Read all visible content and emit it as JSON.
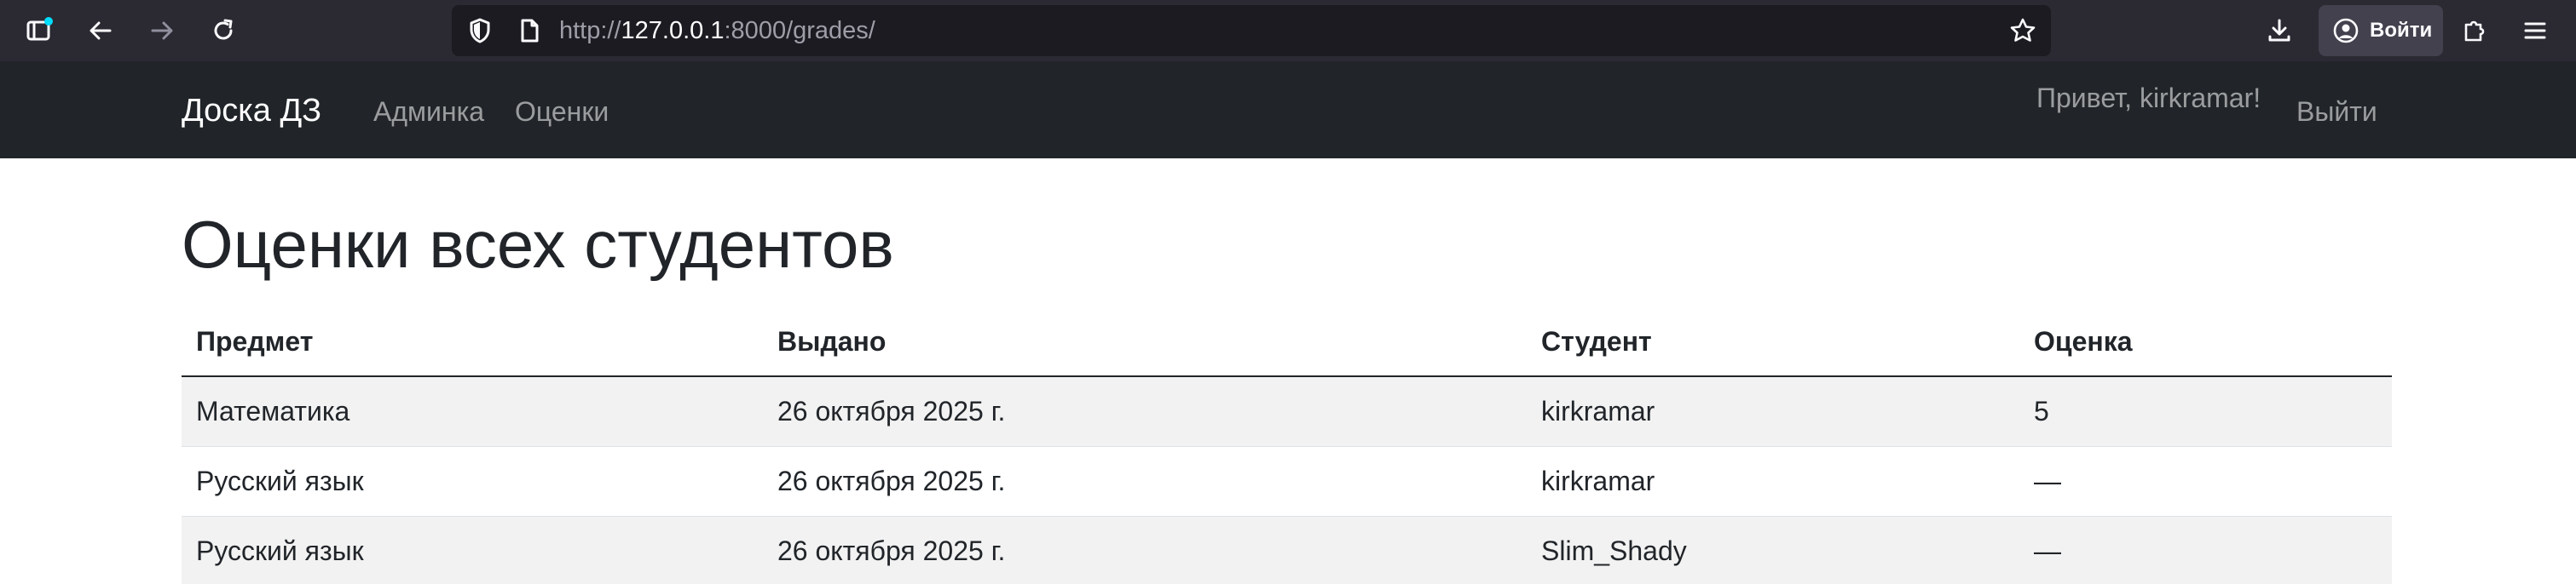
{
  "browser": {
    "url_prefix": "http://",
    "url_host": "127.0.0.1",
    "url_path": ":8000/grades/",
    "signin_label": "Войти",
    "accent": "#2b2a33"
  },
  "navbar": {
    "brand": "Доска ДЗ",
    "links": [
      {
        "label": "Админка"
      },
      {
        "label": "Оценки"
      }
    ],
    "greeting": "Привет, kirkramar!",
    "logout": "Выйти"
  },
  "main": {
    "title": "Оценки всех студентов",
    "table": {
      "headers": [
        "Предмет",
        "Выдано",
        "Студент",
        "Оценка"
      ],
      "rows": [
        [
          "Математика",
          "26 октября 2025 г.",
          "kirkramar",
          "5"
        ],
        [
          "Русский язык",
          "26 октября 2025 г.",
          "kirkramar",
          "—"
        ],
        [
          "Русский язык",
          "26 октября 2025 г.",
          "Slim_Shady",
          "—"
        ]
      ]
    }
  }
}
